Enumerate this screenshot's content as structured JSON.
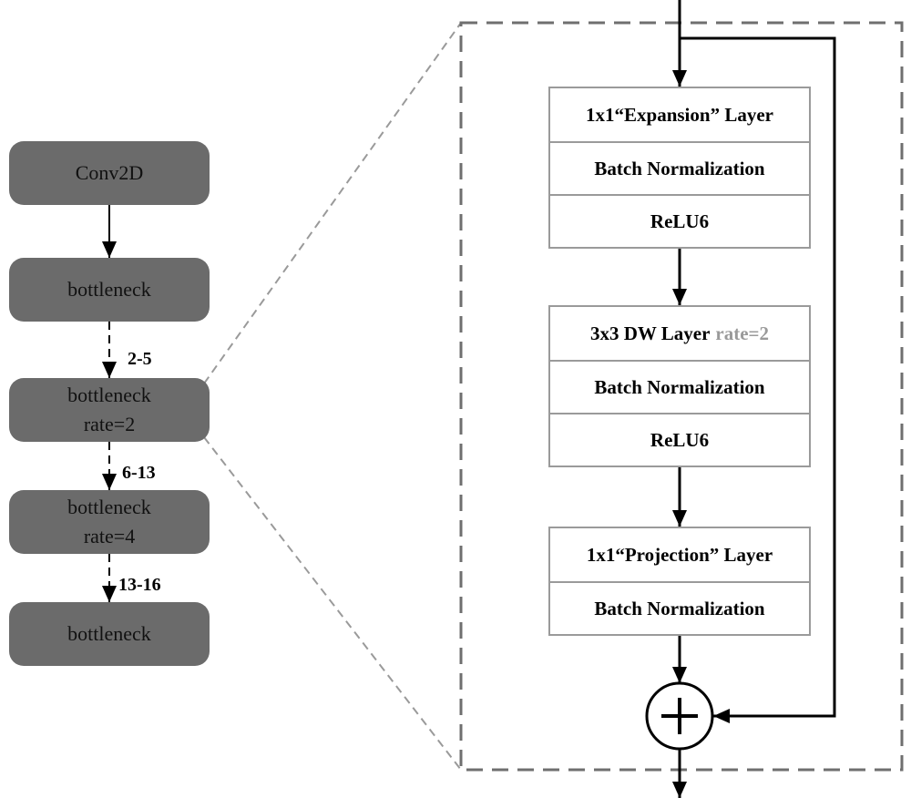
{
  "colors": {
    "left_box_fill": "#6b6b6b",
    "dashed_frame": "#6f6f6f",
    "zoom_lines": "#9a9a9a",
    "block_border": "#9a9a9a",
    "rate_highlight": "#9a9a9a",
    "arrow": "#000000"
  },
  "left_column": {
    "boxes": [
      {
        "line1": "Conv2D",
        "line2": ""
      },
      {
        "line1": "bottleneck",
        "line2": ""
      },
      {
        "line1": "bottleneck",
        "line2": "rate=2"
      },
      {
        "line1": "bottleneck",
        "line2": "rate=4"
      },
      {
        "line1": "bottleneck",
        "line2": ""
      }
    ],
    "repeat_labels": [
      "2-5",
      "6-13",
      "13-16"
    ]
  },
  "detail": {
    "blocks": [
      {
        "rows": [
          {
            "text": "1x1“Expansion” Layer",
            "suffix": ""
          },
          {
            "text": "Batch Normalization",
            "suffix": ""
          },
          {
            "text": "ReLU6",
            "suffix": ""
          }
        ]
      },
      {
        "rows": [
          {
            "text": "3x3 DW Layer",
            "suffix": "rate=2"
          },
          {
            "text": "Batch Normalization",
            "suffix": ""
          },
          {
            "text": "ReLU6",
            "suffix": ""
          }
        ]
      },
      {
        "rows": [
          {
            "text": "1x1“Projection” Layer",
            "suffix": ""
          },
          {
            "text": "Batch Normalization",
            "suffix": ""
          }
        ]
      }
    ],
    "add_node_symbol": "+"
  }
}
